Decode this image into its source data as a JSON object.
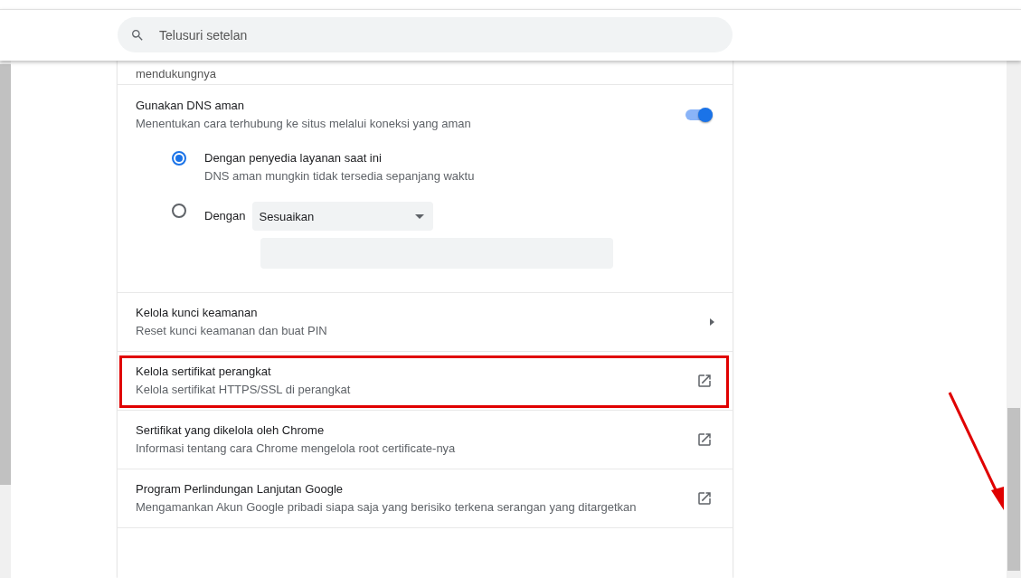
{
  "search": {
    "placeholder": "Telusuri setelan"
  },
  "partial_row": {
    "text": "mendukungnya"
  },
  "dns": {
    "title": "Gunakan DNS aman",
    "description": "Menentukan cara terhubung ke situs melalui koneksi yang aman",
    "on": true,
    "options": [
      {
        "label": "Dengan penyedia layanan saat ini",
        "description": "DNS aman mungkin tidak tersedia sepanjang waktu",
        "selected": true
      },
      {
        "label": "Dengan",
        "selected": false,
        "dropdown": "Sesuaikan"
      }
    ]
  },
  "rows": [
    {
      "kind": "submenu",
      "title": "Kelola kunci keamanan",
      "description": "Reset kunci keamanan dan buat PIN",
      "highlighted": false
    },
    {
      "kind": "external",
      "title": "Kelola sertifikat perangkat",
      "description": "Kelola sertifikat HTTPS/SSL di perangkat",
      "highlighted": true
    },
    {
      "kind": "external",
      "title": "Sertifikat yang dikelola oleh Chrome",
      "description": "Informasi tentang cara Chrome mengelola root certificate-nya",
      "highlighted": false
    },
    {
      "kind": "external",
      "title": "Program Perlindungan Lanjutan Google",
      "description": "Mengamankan Akun Google pribadi siapa saja yang berisiko terkena serangan yang ditargetkan",
      "highlighted": false
    }
  ]
}
